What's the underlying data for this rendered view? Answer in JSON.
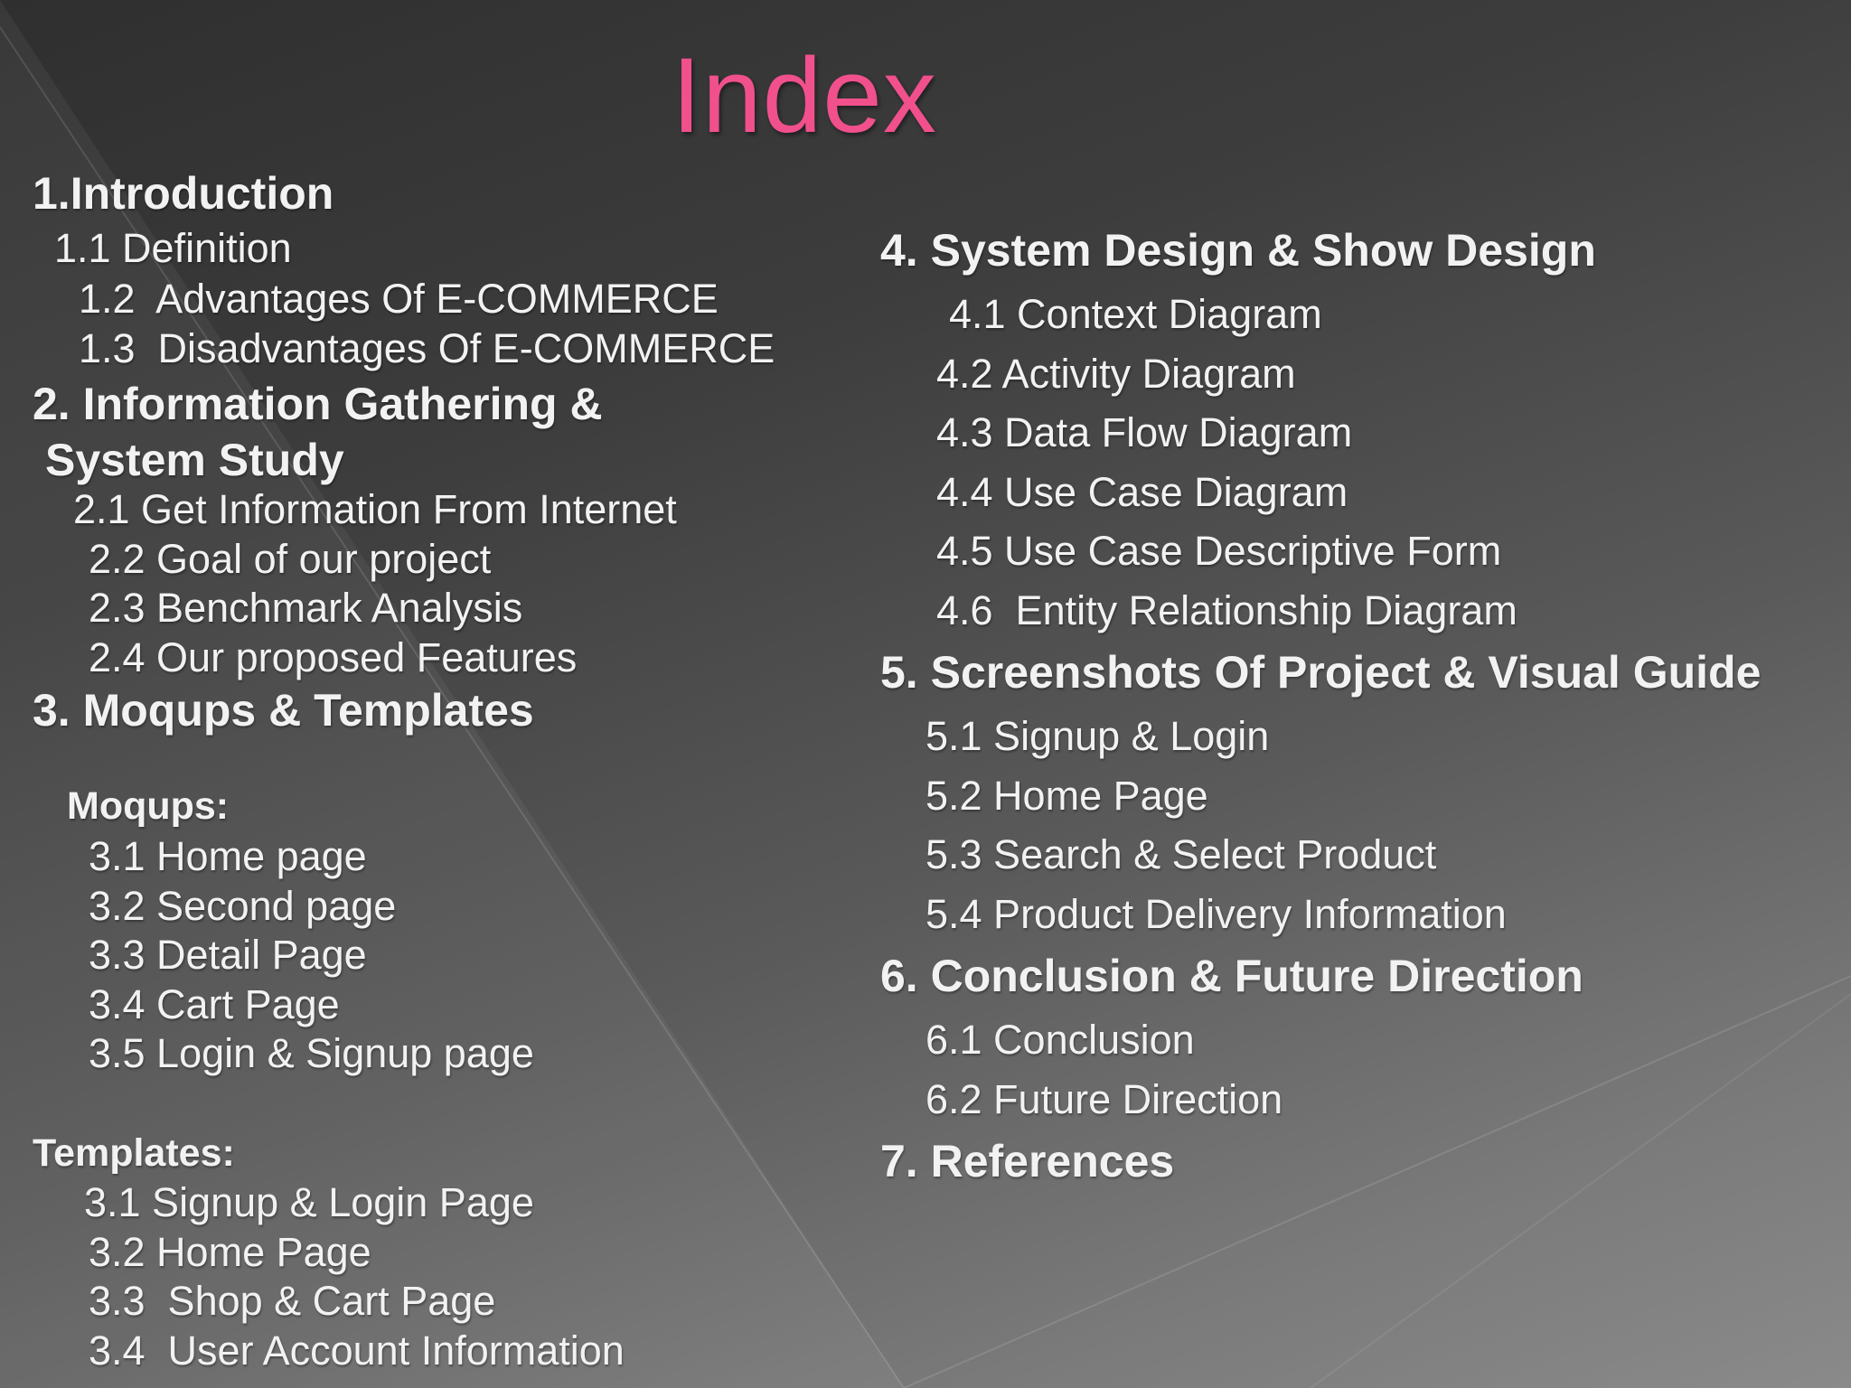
{
  "slide": {
    "title": "Index",
    "colors": {
      "background_dark": "#2f2f2f",
      "background_light": "#8a8a8a",
      "title": "#f0508c",
      "text": "#f2f2f2"
    },
    "left_column": {
      "intro": "1.Introduction",
      "intro_1": "1.1 Definition",
      "intro_2": "1.2  Advantages Of E-COMMERCE",
      "intro_3": "1.3  Disadvantages Of E-COMMERCE",
      "info_a": "2. Information Gathering &",
      "info_b": "System Study",
      "info_1": "2.1 Get Information From Internet",
      "info_2": "2.2 Goal of our project",
      "info_3": "2.3 Benchmark Analysis",
      "info_4": "2.4 Our proposed Features",
      "moq": "3. Moqups & Templates",
      "moqups_label": "Moqups:",
      "moq_1": "3.1 Home page",
      "moq_2": "3.2 Second page",
      "moq_3": "3.3 Detail Page",
      "moq_4": "3.4 Cart Page",
      "moq_5": "3.5 Login & Signup page",
      "templates_label": "Templates:",
      "tpl_1": "3.1 Signup & Login Page",
      "tpl_2": "3.2 Home Page",
      "tpl_3": "3.3  Shop & Cart Page",
      "tpl_4": "3.4  User Account Information"
    },
    "right_column": {
      "sys": "4. System Design & Show Design",
      "sys_1": "4.1 Context Diagram",
      "sys_2": "4.2 Activity Diagram",
      "sys_3": "4.3 Data Flow Diagram",
      "sys_4": "4.4 Use Case Diagram",
      "sys_5": "4.5 Use Case Descriptive Form",
      "sys_6": "4.6  Entity Relationship Diagram",
      "shots": "5. Screenshots Of Project & Visual Guide",
      "shots_1": "5.1 Signup & Login",
      "shots_2": "5.2 Home Page",
      "shots_3": "5.3 Search & Select Product",
      "shots_4": "5.4 Product Delivery Information",
      "conc": "6. Conclusion & Future Direction",
      "conc_1": "6.1 Conclusion",
      "conc_2": "6.2 Future Direction",
      "refs": "7. References"
    }
  }
}
